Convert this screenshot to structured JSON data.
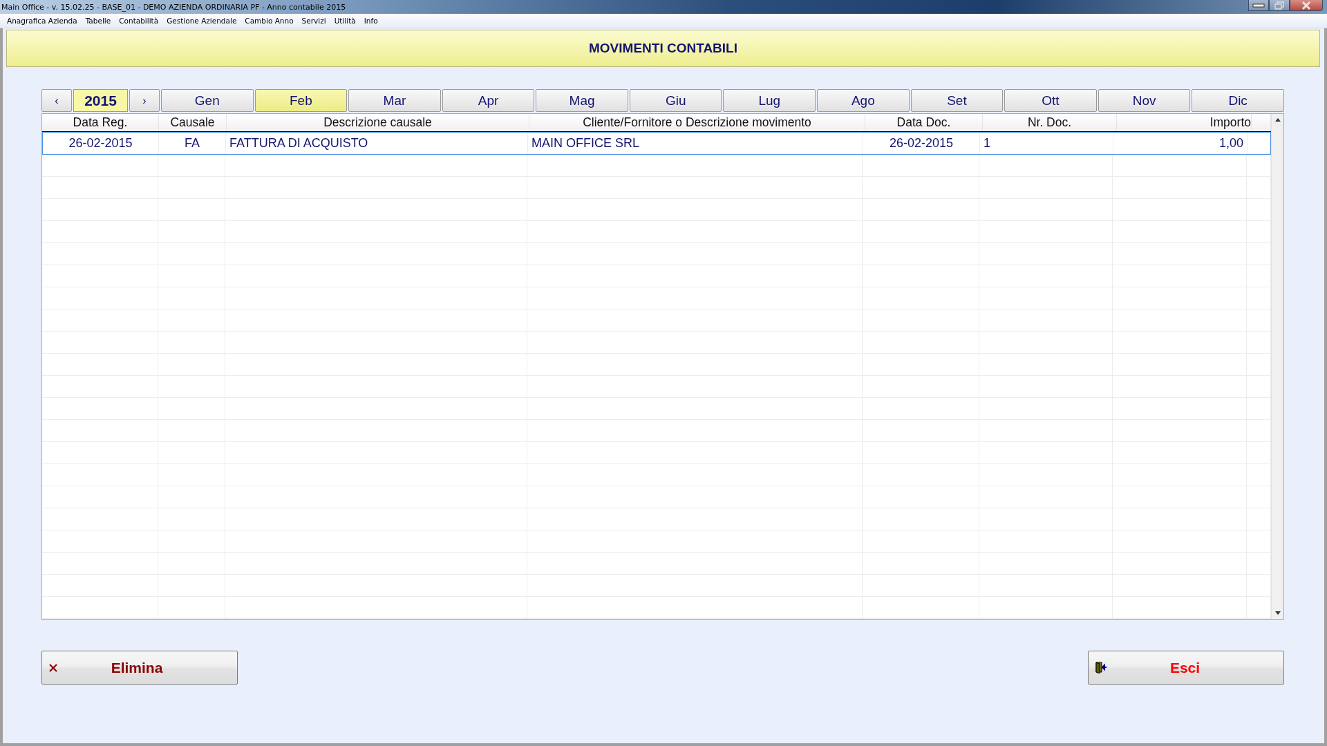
{
  "window": {
    "title": "Main Office - v. 15.02.25 - BASE_01 - DEMO AZIENDA ORDINARIA PF - Anno contabile 2015"
  },
  "menu": [
    "Anagrafica Azienda",
    "Tabelle",
    "Contabilità",
    "Gestione Aziendale",
    "Cambio Anno",
    "Servizi",
    "Utilità",
    "Info"
  ],
  "header": {
    "title": "MOVIMENTI CONTABILI"
  },
  "year_selector": {
    "prev": "‹",
    "year": "2015",
    "next": "›"
  },
  "months": [
    {
      "label": "Gen",
      "selected": false
    },
    {
      "label": "Feb",
      "selected": true
    },
    {
      "label": "Mar",
      "selected": false
    },
    {
      "label": "Apr",
      "selected": false
    },
    {
      "label": "Mag",
      "selected": false
    },
    {
      "label": "Giu",
      "selected": false
    },
    {
      "label": "Lug",
      "selected": false
    },
    {
      "label": "Ago",
      "selected": false
    },
    {
      "label": "Set",
      "selected": false
    },
    {
      "label": "Ott",
      "selected": false
    },
    {
      "label": "Nov",
      "selected": false
    },
    {
      "label": "Dic",
      "selected": false
    }
  ],
  "table": {
    "columns": [
      "Data Reg.",
      "Causale",
      "Descrizione causale",
      "Cliente/Fornitore o Descrizione movimento",
      "Data Doc.",
      "Nr. Doc.",
      "Importo"
    ],
    "rows": [
      {
        "selected": true,
        "cells": [
          "26-02-2015",
          "FA",
          "FATTURA DI ACQUISTO",
          "MAIN OFFICE SRL",
          "26-02-2015",
          "1",
          "1,00"
        ]
      }
    ]
  },
  "buttons": [
    {
      "kind": "delete",
      "label": "Elimina"
    },
    {
      "kind": "exit",
      "label": "Esci"
    }
  ]
}
